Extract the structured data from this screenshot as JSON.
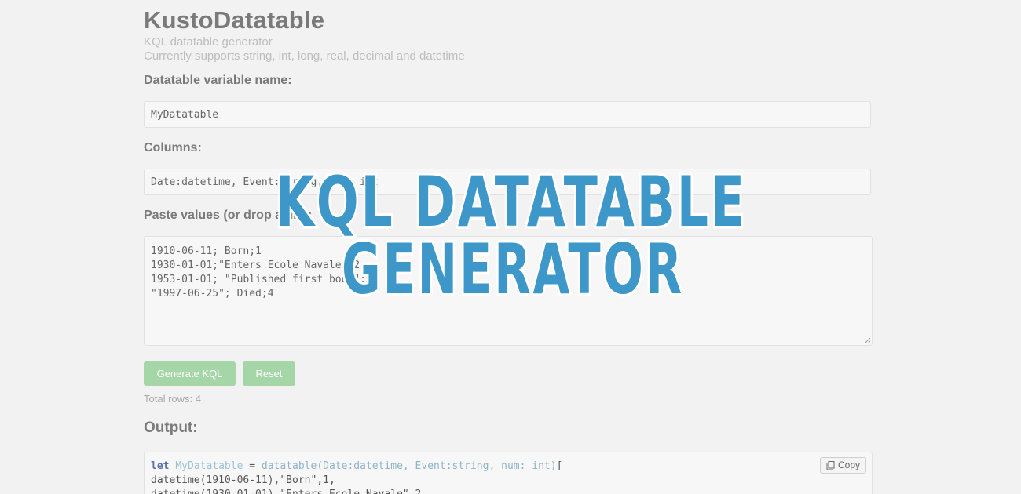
{
  "header": {
    "title": "KustoDatatable",
    "subtitle_1": "KQL datatable generator",
    "subtitle_2": "Currently supports string, int, long, real, decimal and datetime"
  },
  "form": {
    "variable_label": "Datatable variable name:",
    "variable_value": "MyDatatable",
    "columns_label": "Columns:",
    "columns_value": "Date:datetime, Event:string, num: int",
    "values_label": "Paste values (or drop a file):",
    "values_lines": [
      "1910-06-11; Born;1",
      "1930-01-01;\"Enters Ecole Navale\";2",
      "1953-01-01; \"Published first book\";3",
      "\"1997-06-25\"; Died;4"
    ]
  },
  "buttons": {
    "generate_label": "Generate KQL",
    "reset_label": "Reset"
  },
  "status": {
    "total_rows": "Total rows: 4"
  },
  "output": {
    "heading": "Output:",
    "copy_label": "Copy",
    "code_line_1": {
      "keyword": "let",
      "variable": "MyDatatable",
      "equals": " = ",
      "function": "datatable(Date:datetime, Event:string, num: int)",
      "bracket": "["
    },
    "code_line_2": "datetime(1910-06-11),\"Born\",1,",
    "code_line_3": "datetime(1930-01-01),\"Enters Ecole Navale\",2,"
  },
  "overlay": {
    "line_1": "KQL DATATABLE",
    "line_2": "GENERATOR"
  },
  "colors": {
    "background": "#f2f2f2",
    "button_green": "#a5d6a7",
    "banner_blue": "#3e97c9",
    "keyword": "#5a6fb0"
  },
  "icons": {
    "copy": "copy-icon",
    "resize": "resize-grip-icon"
  }
}
